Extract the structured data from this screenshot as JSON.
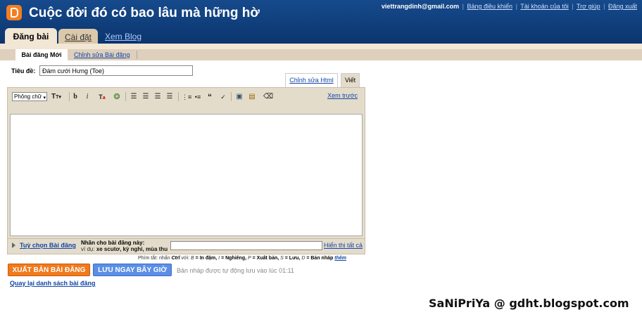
{
  "header": {
    "blog_title": "Cuộc đời đó có bao lâu mà hững hờ",
    "email": "viettrangdinh@gmail.com",
    "links": [
      "Bảng điều khiển",
      "Tài khoản của tôi",
      "Trợ giúp",
      "Đăng xuất"
    ],
    "tabs": [
      "Đăng bài",
      "Cài đặt",
      "Xem Blog"
    ]
  },
  "subtabs": [
    "Bài đăng Mới",
    "Chỉnh sửa Bài đăng"
  ],
  "post": {
    "title_label": "Tiêu đề:",
    "title_value": "Đám cưới Hưng (Toe)"
  },
  "editor": {
    "tab_html": "Chỉnh sửa Html",
    "tab_compose": "Viết",
    "font_select": "Phông chữ",
    "preview_link": "Xem trước",
    "toolbar_icons": [
      "font-size-icon",
      "bold-icon",
      "italic-icon",
      "text-color-icon",
      "link-icon",
      "align-left-icon",
      "align-center-icon",
      "align-right-icon",
      "justify-icon",
      "numbered-list-icon",
      "bullet-list-icon",
      "quote-icon",
      "spellcheck-icon",
      "image-icon",
      "video-icon",
      "remove-format-icon"
    ]
  },
  "options": {
    "post_options_link": "Tuỳ chọn Bài đăng",
    "labels_label": "Nhãn cho bài đăng này:",
    "labels_hint_prefix": "ví dụ:",
    "labels_hint_examples": "xe scutơ, kỳ nghỉ, mùa thu",
    "show_all": "Hiển thị tất cả"
  },
  "shortcuts": {
    "text": "Phím tắt: nhấn",
    "key": "Ctrl",
    "with": "với:",
    "b": "B",
    "b_desc": "= In đậm,",
    "i": "I",
    "i_desc": "= Nghiêng,",
    "p": "P",
    "p_desc": "= Xuất bản,",
    "s": "S",
    "s_desc": "= Lưu,",
    "d": "D",
    "d_desc": "= Bản nháp",
    "more": "thêm"
  },
  "actions": {
    "publish": "XUẤT BẢN BÀI ĐĂNG",
    "save": "LƯU NGAY BÂY GIỜ",
    "autosave": "Bản nháp được tự động lưu vào lúc 01:11",
    "back": "Quay lại danh sách bài đăng"
  },
  "watermark": "SaNiPriYa @ gdht.blogspot.com",
  "colors": {
    "header": "#0b356e",
    "accent_orange": "#f07a1d",
    "accent_blue": "#5b8ee6",
    "panel": "#e4dccb"
  }
}
